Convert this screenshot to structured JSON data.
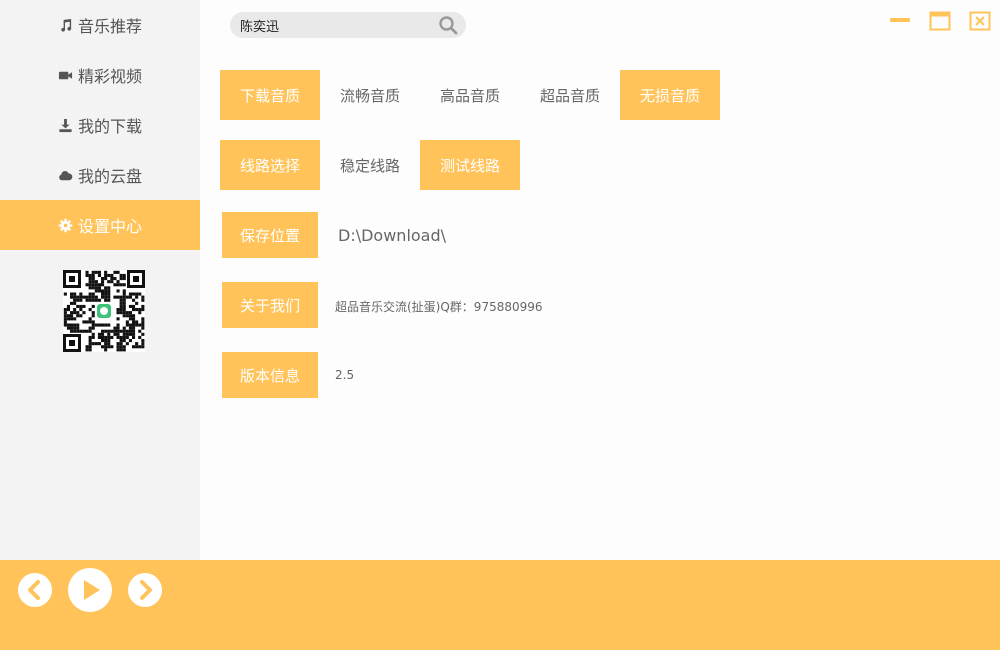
{
  "sidebar": {
    "items": [
      {
        "label": "音乐推荐",
        "icon": "music-note-icon"
      },
      {
        "label": "精彩视频",
        "icon": "video-camera-icon"
      },
      {
        "label": "我的下载",
        "icon": "download-icon"
      },
      {
        "label": "我的云盘",
        "icon": "cloud-icon"
      },
      {
        "label": "设置中心",
        "icon": "gear-icon",
        "active": true
      }
    ],
    "qr_code": "qr-code-icon"
  },
  "search": {
    "value": "陈奕迅",
    "icon": "search-icon"
  },
  "window_controls": [
    "minimize-icon",
    "maximize-icon",
    "close-icon"
  ],
  "settings": {
    "quality": {
      "label": "下载音质",
      "options": [
        "流畅音质",
        "高品音质",
        "超品音质",
        "无损音质"
      ],
      "selected": "无损音质"
    },
    "route": {
      "label": "线路选择",
      "options": [
        "稳定线路",
        "测试线路"
      ],
      "selected": "测试线路"
    },
    "save_location": {
      "label": "保存位置",
      "value": "D:\\Download\\"
    },
    "about": {
      "label": "关于我们",
      "value": "超品音乐交流(扯蛋)Q群：975880996"
    },
    "version": {
      "label": "版本信息",
      "value": "2.5"
    }
  },
  "player": {
    "controls": [
      "previous-icon",
      "play-icon",
      "next-icon"
    ]
  },
  "colors": {
    "accent": "#ffc35a",
    "sidebar_bg": "#f3f3f3",
    "text": "#666666"
  }
}
